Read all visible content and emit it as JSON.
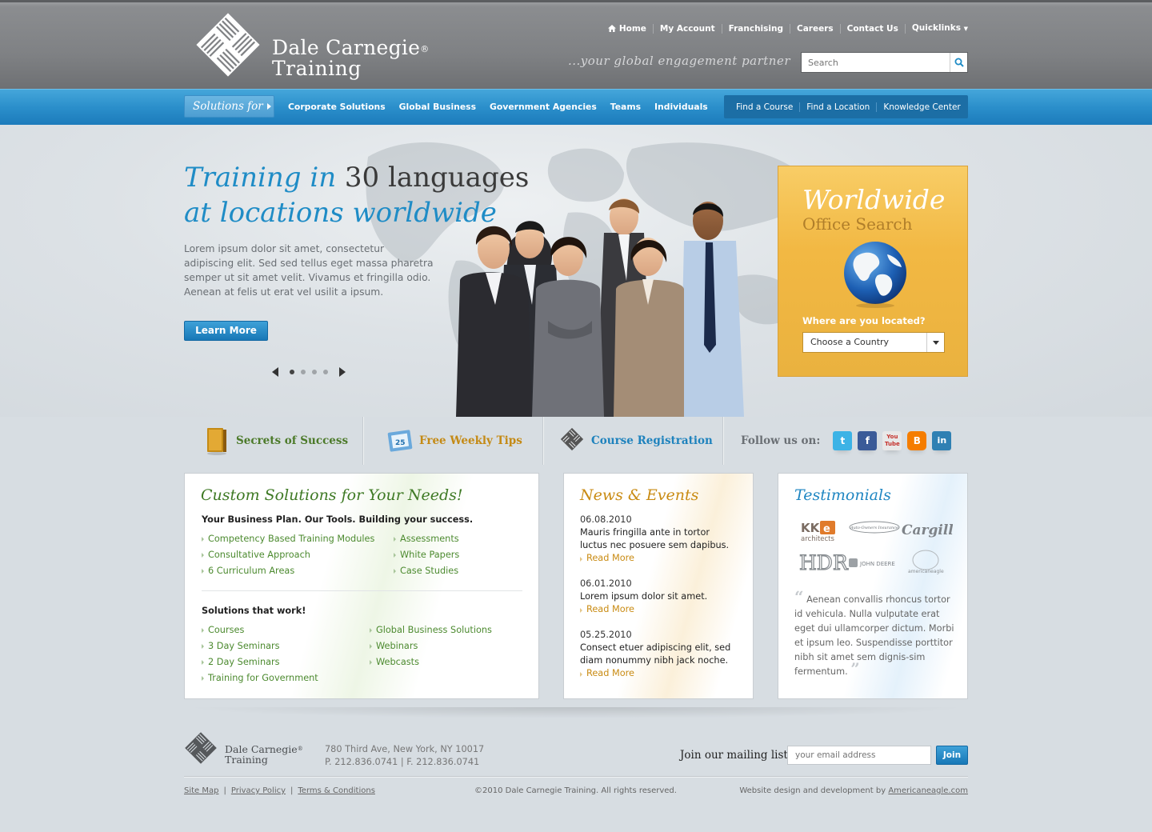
{
  "header": {
    "logo_line1": "Dale Carnegie",
    "logo_line2": "Training",
    "logo_reg": "®",
    "tagline": "...your global engagement partner",
    "util_nav": [
      "Home",
      "My Account",
      "Franchising",
      "Careers",
      "Contact Us",
      "Quicklinks"
    ],
    "search_placeholder": "Search"
  },
  "nav": {
    "solutions_for": "Solutions for",
    "main": [
      "Corporate Solutions",
      "Global Business",
      "Government Agencies",
      "Teams",
      "Individuals"
    ],
    "right": [
      "Find a Course",
      "Find a Location",
      "Knowledge Center"
    ]
  },
  "hero": {
    "title_a": "Training in ",
    "title_b": "30 languages",
    "title_c": "at locations worldwide",
    "body": "Lorem ipsum dolor sit amet, consectetur adipiscing elit. Sed sed tellus eget massa pharetra semper ut sit amet velit. Vivamus et fringilla odio. Aenean at felis ut erat vel usilit a ipsum.",
    "cta": "Learn More",
    "slides_total": 4,
    "slide_active": 1
  },
  "worldwide": {
    "title": "Worldwide",
    "subtitle": "Office Search",
    "question": "Where are you located?",
    "select_value": "Choose a Country"
  },
  "strip": {
    "secrets": "Secrets of Success",
    "tips": "Free Weekly Tips",
    "registration": "Course Registration",
    "follow": "Follow us on:",
    "social": [
      "twitter-icon",
      "facebook-icon",
      "youtube-icon",
      "blogger-icon",
      "linkedin-icon"
    ]
  },
  "solutions_box": {
    "title": "Custom Solutions for Your Needs!",
    "sub1": "Your Business Plan. Our Tools. Building your success.",
    "list1_left": [
      "Competency Based Training Modules",
      "Consultative Approach",
      "6 Curriculum Areas"
    ],
    "list1_right": [
      "Assessments",
      "White Papers",
      "Case Studies"
    ],
    "sub2": "Solutions that work!",
    "list2_left": [
      "Courses",
      "3 Day Seminars",
      "2 Day Seminars",
      "Training for Government"
    ],
    "list2_right": [
      "Global Business Solutions",
      "Webinars",
      "Webcasts"
    ]
  },
  "news_box": {
    "title": "News & Events",
    "items": [
      {
        "date": "06.08.2010",
        "text": "Mauris fringilla ante in tortor luctus nec posuere sem dapibus.",
        "more": "Read More"
      },
      {
        "date": "06.01.2010",
        "text": "Lorem ipsum dolor sit amet.",
        "more": "Read More"
      },
      {
        "date": "05.25.2010",
        "text": "Consect etuer adipiscing elit, sed diam nonummy nibh jack noche.",
        "more": "Read More"
      }
    ]
  },
  "testimonials": {
    "title": "Testimonials",
    "logos": [
      "KKE architects",
      "Auto-Owners Insurance",
      "Cargill",
      "HDR",
      "John Deere",
      "americaneagle.com"
    ],
    "quote": "Aenean convallis rhoncus tortor id vehicula. Nulla vulputate erat eget dui ullamcorper dictum. Morbi et ipsum leo. Suspendisse porttitor nibh sit amet sem dignis-sim fermentum.",
    "quote_open": "“",
    "quote_close": "”"
  },
  "footer": {
    "logo_line1": "Dale Carnegie",
    "logo_line2": "Training",
    "logo_reg": "®",
    "address": "780 Third Ave, New York, NY  10017",
    "phones": "P. 212.836.0741   |   F. 212.836.0741",
    "mailing_label": "Join our mailing list",
    "email_placeholder": "your email address",
    "join": "Join",
    "links": [
      "Site Map",
      "Privacy Policy",
      "Terms & Conditions"
    ],
    "copyright": "©2010 Dale Carnegie Training. All rights reserved.",
    "credit_prefix": "Website design and development by ",
    "credit_link": "Americaneagle.com"
  },
  "colors": {
    "brand_blue": "#1f8cc6",
    "accent_orange": "#f2b843",
    "green": "#4c8a2f"
  }
}
